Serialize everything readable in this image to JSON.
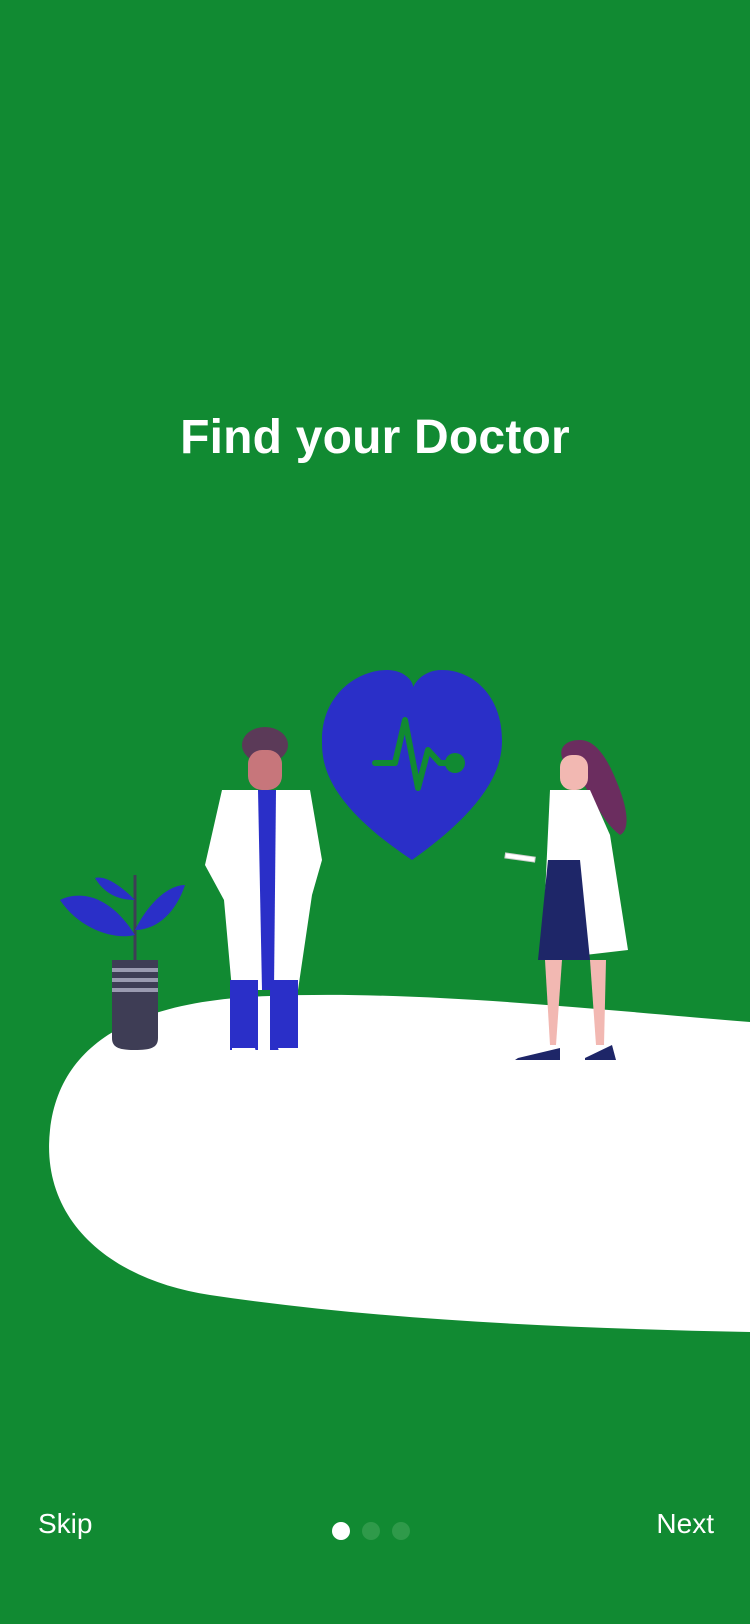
{
  "onboarding": {
    "title": "Find your Doctor",
    "skip_label": "Skip",
    "next_label": "Next",
    "page_indicator": {
      "total": 3,
      "active": 1
    }
  },
  "colors": {
    "background": "#118A32",
    "heart": "#2A2FC8",
    "path": "#FFFFFF",
    "dot_inactive": "#2F9A4A",
    "dot_active": "#FFFFFF"
  },
  "illustration": {
    "icons": [
      "heart-pulse-icon",
      "plant-pot-icon",
      "male-doctor-figure",
      "female-doctor-figure"
    ]
  }
}
